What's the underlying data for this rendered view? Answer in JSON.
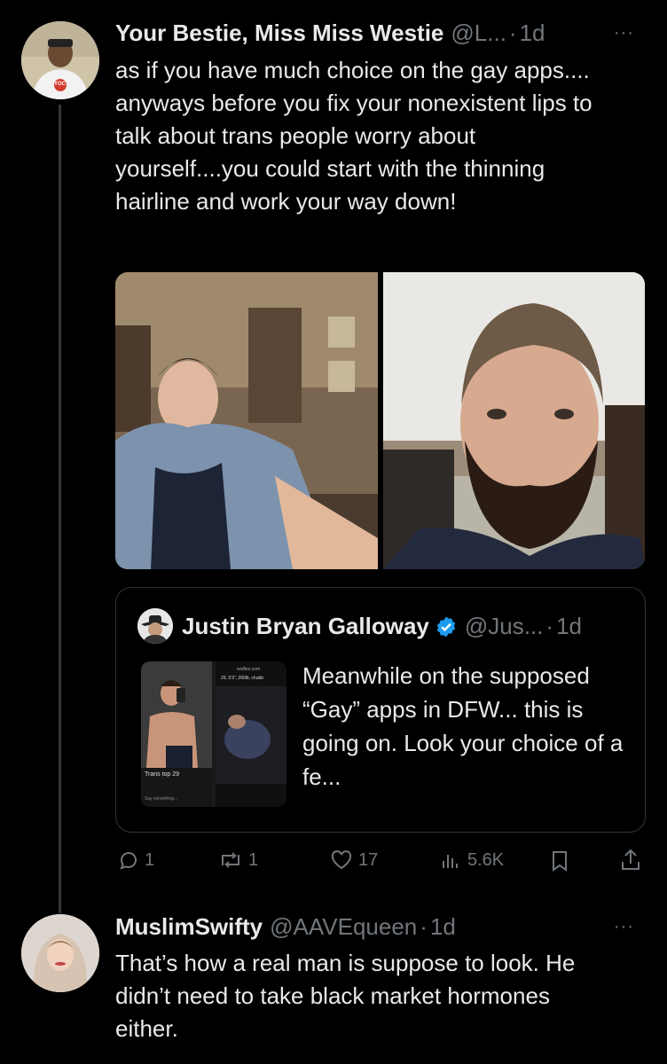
{
  "tweet1": {
    "display_name": "Your Bestie, Miss Miss Westie",
    "handle": "@L...",
    "sep": "·",
    "time": "1d",
    "more": "···",
    "text": "as if you have much choice on the gay apps.... anyways before you fix your nonexistent lips to talk about trans people worry about yourself....you could start with the thinning hairline and work your way down!",
    "media": [
      {
        "alt": "photo-man-in-raglan-tee-in-kitchen"
      },
      {
        "alt": "selfie-bearded-man-in-car"
      }
    ],
    "avatar_shirt_text": "YOC"
  },
  "quote": {
    "display_name": "Justin Bryan Galloway",
    "handle": "@Jus...",
    "sep": "·",
    "time": "1d",
    "text": "Meanwhile on the supposed “Gay” apps in DFW... this is going on. Look your choice of a fe...",
    "thumb": {
      "profile_label": "Trans top 29",
      "url_text": "wolfies.com",
      "detail_text": "29, 5'3\", 260lb, chubb",
      "say_something": "Say something..."
    }
  },
  "actions": {
    "replies": "1",
    "reposts": "1",
    "likes": "17",
    "views": "5.6K"
  },
  "tweet2": {
    "display_name": "MuslimSwifty",
    "handle": "@AAVEqueen",
    "sep": "·",
    "time": "1d",
    "more": "···",
    "text": "That’s how a real man is suppose to look. He didn’t need to take black market hormones either."
  },
  "colors": {
    "background": "#000000",
    "text": "#e7e9ea",
    "muted": "#71767b",
    "border": "#2f3336",
    "verified": "#1d9bf0"
  }
}
